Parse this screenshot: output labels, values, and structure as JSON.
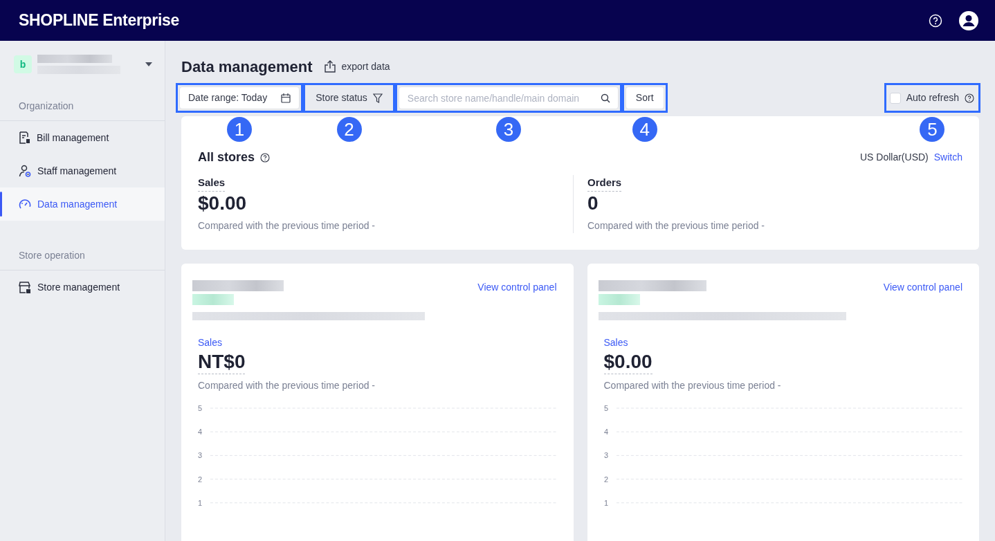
{
  "header": {
    "logo": "SHOPLINE Enterprise"
  },
  "sidebar": {
    "store": {
      "initial": "b"
    },
    "sections": [
      {
        "title": "Organization",
        "items": [
          {
            "label": "Bill management",
            "selected": false
          },
          {
            "label": "Staff management",
            "selected": false
          },
          {
            "label": "Data management",
            "selected": true
          }
        ]
      },
      {
        "title": "Store operation",
        "items": [
          {
            "label": "Store management",
            "selected": false
          }
        ]
      }
    ]
  },
  "page": {
    "title": "Data management",
    "export": "export data"
  },
  "toolbar": {
    "date_range": {
      "label": "Date range:",
      "value": "Today",
      "marker": "1"
    },
    "status_filter": {
      "label": "Store status",
      "marker": "2"
    },
    "search": {
      "placeholder": "Search store name/handle/main domain",
      "marker": "3"
    },
    "sort": {
      "label": "Sort",
      "marker": "4"
    },
    "auto_refresh": {
      "label": "Auto refresh",
      "checked": false,
      "marker": "5"
    }
  },
  "summary": {
    "title": "All stores",
    "currency": "US Dollar(USD)",
    "switch": "Switch",
    "metrics": [
      {
        "label": "Sales",
        "value": "$0.00",
        "comparison": "Compared with the previous time period -"
      },
      {
        "label": "Orders",
        "value": "0",
        "comparison": "Compared with the previous time period -"
      }
    ]
  },
  "stores": [
    {
      "link": "View control panel",
      "metric_label": "Sales",
      "value": "NT$0",
      "comparison": "Compared with the previous time period -",
      "chart_axis_labels": [
        "5",
        "4",
        "3",
        "2",
        "1"
      ]
    },
    {
      "link": "View control panel",
      "metric_label": "Sales",
      "value": "$0.00",
      "comparison": "Compared with the previous time period -",
      "chart_axis_labels": [
        "5",
        "4",
        "3",
        "2",
        "1"
      ]
    }
  ]
}
